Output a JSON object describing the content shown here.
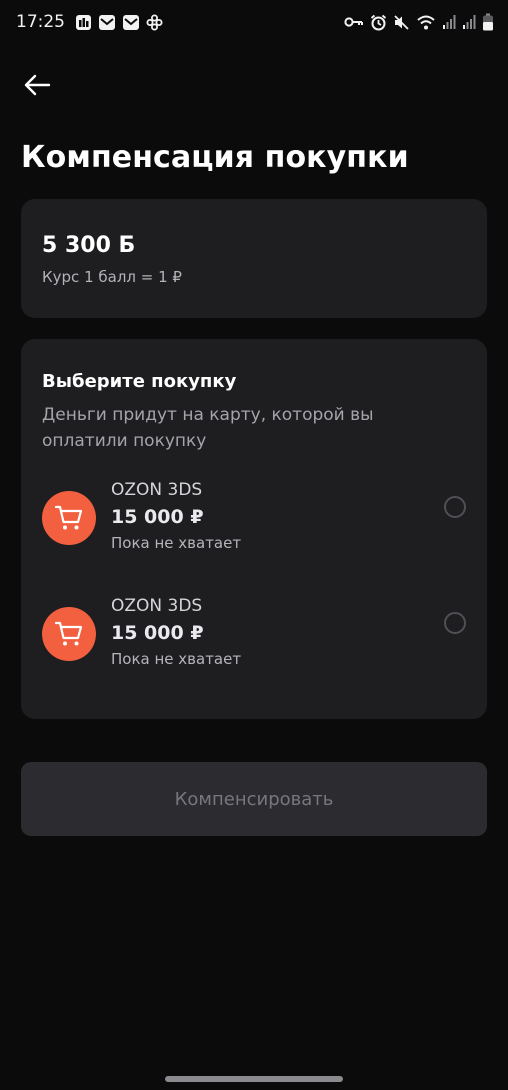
{
  "status_bar": {
    "time": "17:25",
    "icons_left": [
      "app-icon",
      "mail-icon",
      "mail-icon",
      "flower-icon"
    ],
    "icons_right": [
      "key-icon",
      "alarm-icon",
      "mute-icon",
      "wifi-icon",
      "signal-icon",
      "signal-icon",
      "battery-icon"
    ]
  },
  "header": {
    "back_icon": "arrow-left-icon",
    "title": "Компенсация покупки"
  },
  "balance": {
    "amount": "5 300 Б",
    "rate": "Курс 1 балл = 1 ₽"
  },
  "purchases": {
    "title": "Выберите покупку",
    "subtitle": "Деньги придут на карту, которой вы оплатили покупку",
    "items": [
      {
        "merchant": "OZON 3DS",
        "amount": "15 000 ₽",
        "status": "Пока не хватает",
        "icon": "cart-icon",
        "selected": false
      },
      {
        "merchant": "OZON 3DS",
        "amount": "15 000 ₽",
        "status": "Пока не хватает",
        "icon": "cart-icon",
        "selected": false
      }
    ]
  },
  "actions": {
    "compensate_label": "Компенсировать",
    "compensate_enabled": false
  },
  "colors": {
    "background": "#0b0b0c",
    "card": "#1e1e21",
    "accent_cart": "#f2603f",
    "button_disabled": "#2c2c30"
  }
}
